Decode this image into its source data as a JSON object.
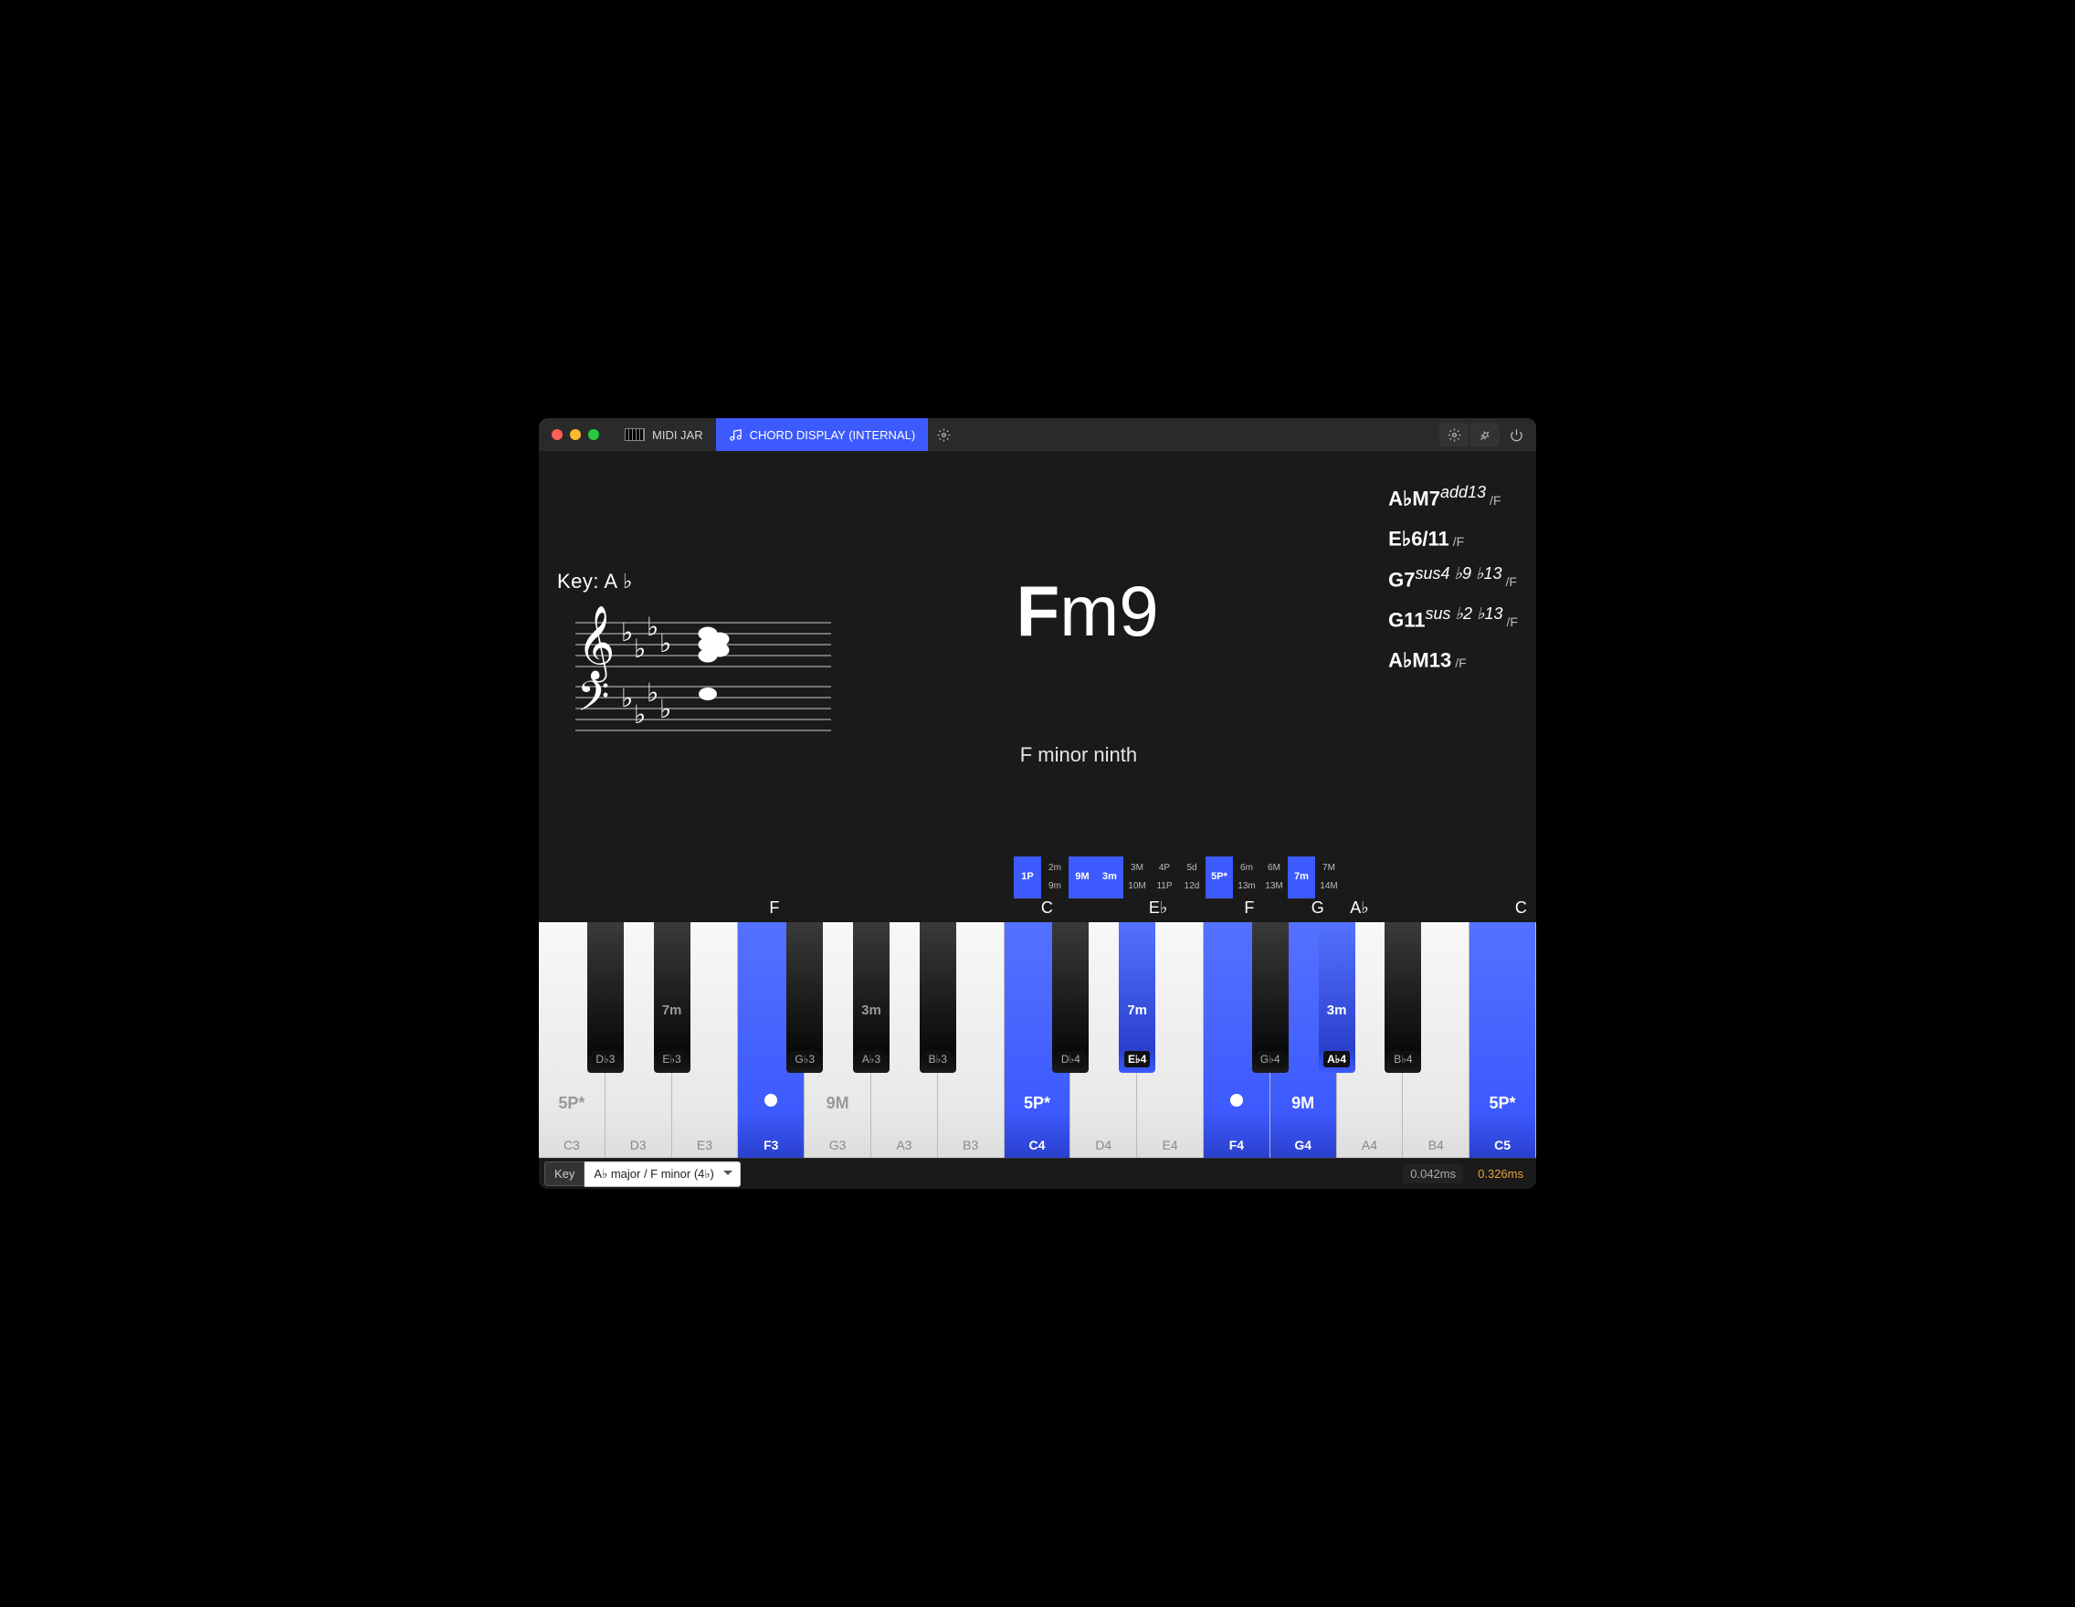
{
  "titlebar": {
    "tab1": "MIDI JAR",
    "tab2": "CHORD DISPLAY (INTERNAL)"
  },
  "key": {
    "label": "Key: A ♭"
  },
  "chord": {
    "root": "F",
    "suffix": "m9",
    "fullname": "F minor ninth"
  },
  "alt_chords": [
    {
      "root": "A♭M7",
      "ext": "add13",
      "bass": "/F"
    },
    {
      "root": "E♭6/11",
      "ext": "",
      "bass": "/F"
    },
    {
      "root": "G7",
      "ext": "sus4 ♭9 ♭13",
      "bass": "/F"
    },
    {
      "root": "G11",
      "ext": "sus ♭2 ♭13",
      "bass": "/F"
    },
    {
      "root": "A♭M13",
      "ext": "",
      "bass": "/F"
    }
  ],
  "intervals": [
    {
      "top": "1P",
      "bot": "",
      "active": true
    },
    {
      "top": "2m",
      "bot": "9m",
      "active": false
    },
    {
      "top": "9M",
      "bot": "",
      "active": true
    },
    {
      "top": "3m",
      "bot": "",
      "active": true
    },
    {
      "top": "3M",
      "bot": "10M",
      "active": false
    },
    {
      "top": "4P",
      "bot": "11P",
      "active": false
    },
    {
      "top": "5d",
      "bot": "12d",
      "active": false
    },
    {
      "top": "5P*",
      "bot": "",
      "active": true
    },
    {
      "top": "6m",
      "bot": "13m",
      "active": false
    },
    {
      "top": "6M",
      "bot": "13M",
      "active": false
    },
    {
      "top": "7m",
      "bot": "",
      "active": true
    },
    {
      "top": "7M",
      "bot": "14M",
      "active": false
    }
  ],
  "note_labels": [
    {
      "name": "F",
      "pos": 24.8
    },
    {
      "name": "C",
      "pos": 53.5
    },
    {
      "name": "E♭",
      "pos": 65.2
    },
    {
      "name": "F",
      "pos": 74.8
    },
    {
      "name": "G",
      "pos": 82.0
    },
    {
      "name": "A♭",
      "pos": 86.4
    },
    {
      "name": "C",
      "pos": 103.4
    }
  ],
  "white_keys": [
    {
      "label": "C3",
      "active": false,
      "interval": "5P*"
    },
    {
      "label": "D3",
      "active": false
    },
    {
      "label": "E3",
      "active": false
    },
    {
      "label": "F3",
      "active": true,
      "dot": true
    },
    {
      "label": "G3",
      "active": false,
      "interval": "9M"
    },
    {
      "label": "A3",
      "active": false
    },
    {
      "label": "B3",
      "active": false
    },
    {
      "label": "C4",
      "active": true,
      "interval": "5P*"
    },
    {
      "label": "D4",
      "active": false
    },
    {
      "label": "E4",
      "active": false
    },
    {
      "label": "F4",
      "active": true,
      "dot": true
    },
    {
      "label": "G4",
      "active": true,
      "interval": "9M"
    },
    {
      "label": "A4",
      "active": false
    },
    {
      "label": "B4",
      "active": false
    },
    {
      "label": "C5",
      "active": true,
      "interval": "5P*"
    }
  ],
  "black_keys": [
    {
      "label": "D♭3",
      "pos": 6.67,
      "interval": "",
      "active": false
    },
    {
      "label": "E♭3",
      "pos": 13.33,
      "interval": "7m",
      "active": false
    },
    {
      "label": "G♭3",
      "pos": 26.67,
      "interval": "",
      "active": false
    },
    {
      "label": "A♭3",
      "pos": 33.33,
      "interval": "3m",
      "active": false
    },
    {
      "label": "B♭3",
      "pos": 40.0,
      "interval": "",
      "active": false
    },
    {
      "label": "D♭4",
      "pos": 53.33,
      "interval": "",
      "active": false
    },
    {
      "label": "E♭4",
      "pos": 60.0,
      "interval": "7m",
      "active": true
    },
    {
      "label": "G♭4",
      "pos": 73.33,
      "interval": "",
      "active": false
    },
    {
      "label": "A♭4",
      "pos": 80.0,
      "interval": "3m",
      "active": true
    },
    {
      "label": "B♭4",
      "pos": 86.67,
      "interval": "",
      "active": false
    }
  ],
  "footer": {
    "key_label": "Key",
    "key_value": "A♭ major / F minor (4♭)",
    "latency_a": "0.042ms",
    "latency_b": "0.326ms"
  }
}
